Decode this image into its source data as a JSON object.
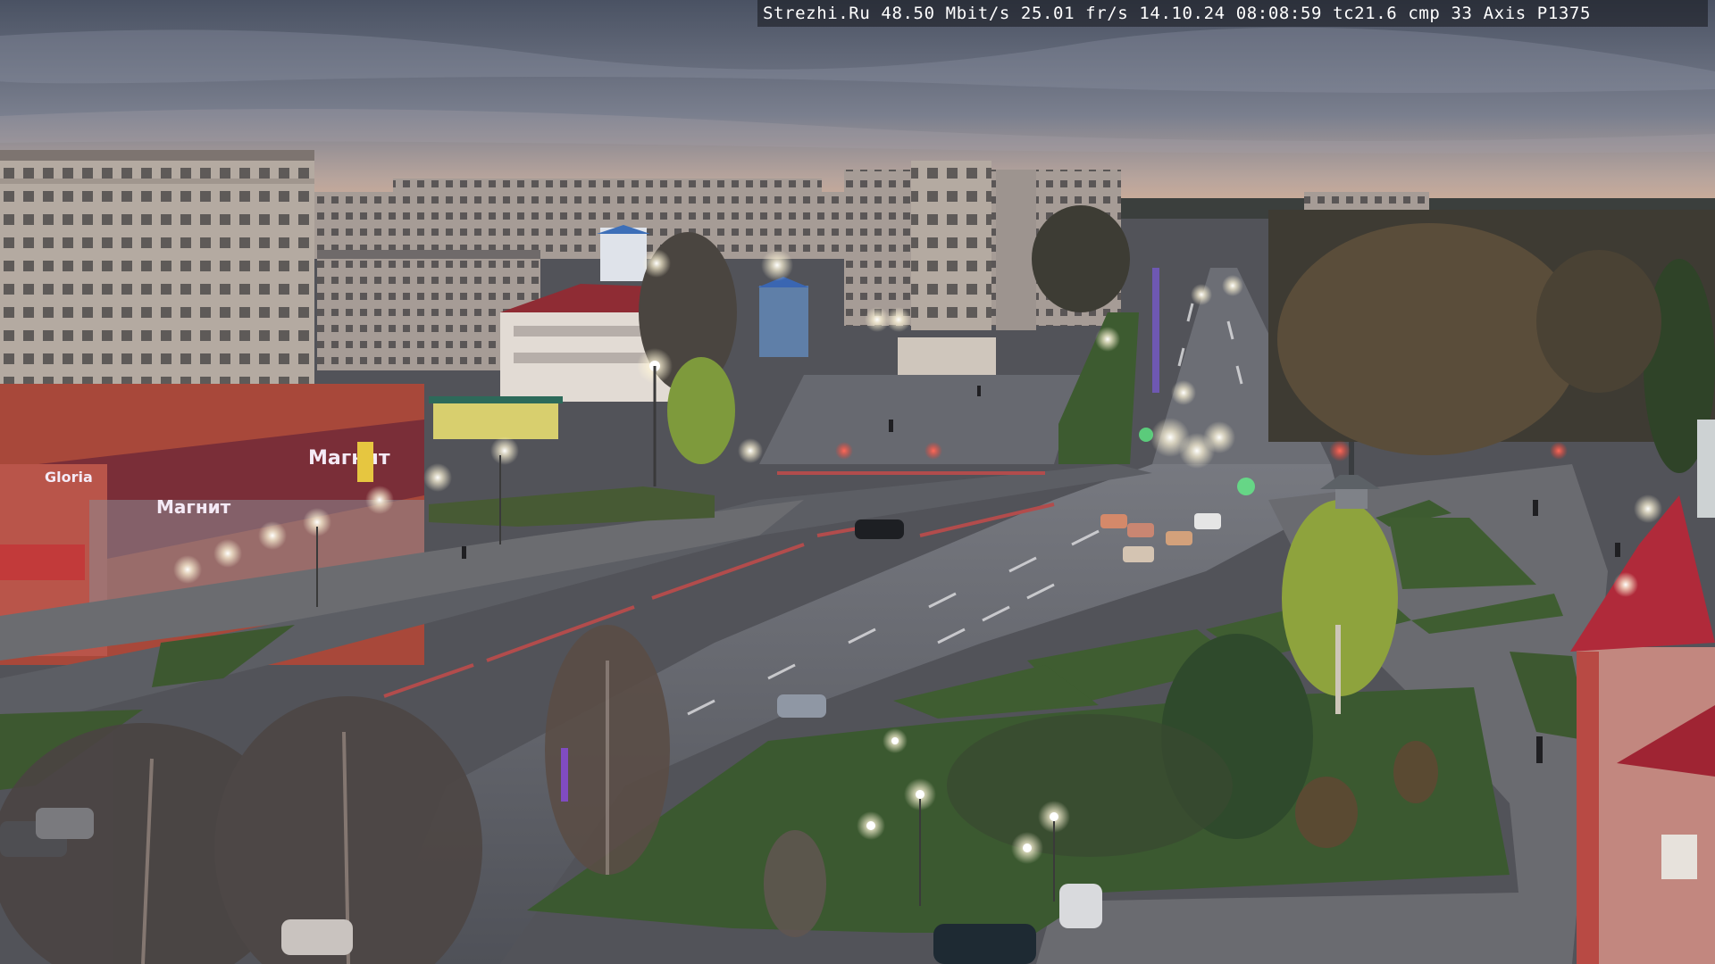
{
  "overlay": {
    "caption": "Strezhi.Ru 48.50 Mbit/s 25.01 fr/s 14.10.24 08:08:59  tc21.6  cmp 33   Axis P1375"
  },
  "signs": {
    "store_left": "Gloria",
    "store_mid": "Магнит",
    "store_right": "Магнит"
  },
  "colors": {
    "sky_top": "#4e5566",
    "sky_horizon": "#c7a996",
    "asphalt": "#5f6168",
    "grass": "#3f5a2e",
    "building_panel": "#b8aea6",
    "brick_red": "#b0493a",
    "dome_red": "#b02a3a"
  }
}
